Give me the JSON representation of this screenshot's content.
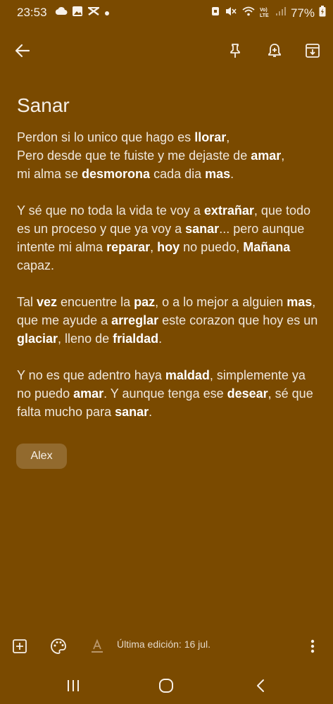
{
  "status_bar": {
    "time": "23:53",
    "battery_percent": "77%",
    "notification_icons": [
      "cloud-icon",
      "gallery-icon",
      "capcut-icon",
      "dot-icon"
    ],
    "system_icons": [
      "alarm-icon",
      "mute-icon",
      "wifi-calling-icon",
      "lte-icon",
      "signal-icon",
      "battery-icon"
    ],
    "network_label": "Vo) LTE"
  },
  "toolbar": {
    "icons": [
      "back-arrow-icon",
      "pin-icon",
      "reminder-icon",
      "archive-icon"
    ]
  },
  "note": {
    "title": "Sanar",
    "paragraphs": [
      [
        {
          "t": "Perdon si lo unico que hago es "
        },
        {
          "t": "llorar",
          "b": true
        },
        {
          "t": ",\nPero desde que te fuiste y me dejaste de "
        },
        {
          "t": "amar",
          "b": true
        },
        {
          "t": ",\nmi alma se "
        },
        {
          "t": "desmorona",
          "b": true
        },
        {
          "t": " cada dia "
        },
        {
          "t": "mas",
          "b": true
        },
        {
          "t": "."
        }
      ],
      [
        {
          "t": "Y sé que no toda la vida te voy a "
        },
        {
          "t": "extrañar",
          "b": true
        },
        {
          "t": ", que todo es un proceso y que ya voy a "
        },
        {
          "t": "sanar",
          "b": true
        },
        {
          "t": "... pero aunque intente mi alma "
        },
        {
          "t": "reparar",
          "b": true
        },
        {
          "t": ", "
        },
        {
          "t": "hoy",
          "b": true
        },
        {
          "t": " no puedo, "
        },
        {
          "t": "Mañana",
          "b": true
        },
        {
          "t": " capaz."
        }
      ],
      [
        {
          "t": "Tal "
        },
        {
          "t": "vez",
          "b": true
        },
        {
          "t": " encuentre la "
        },
        {
          "t": "paz",
          "b": true
        },
        {
          "t": ", o a lo mejor a alguien "
        },
        {
          "t": "mas",
          "b": true
        },
        {
          "t": ", que me ayude a "
        },
        {
          "t": "arreglar",
          "b": true
        },
        {
          "t": " este corazon que hoy es un "
        },
        {
          "t": "glaciar",
          "b": true
        },
        {
          "t": ", lleno de "
        },
        {
          "t": "frialdad",
          "b": true
        },
        {
          "t": "."
        }
      ],
      [
        {
          "t": "Y no es que adentro haya "
        },
        {
          "t": "maldad",
          "b": true
        },
        {
          "t": ", simplemente ya no puedo "
        },
        {
          "t": "amar",
          "b": true
        },
        {
          "t": ". Y aunque tenga ese "
        },
        {
          "t": "desear",
          "b": true
        },
        {
          "t": ", sé que falta mucho para "
        },
        {
          "t": "sanar",
          "b": true
        },
        {
          "t": "."
        }
      ]
    ],
    "label": "Alex",
    "background_color": "#7a4a00"
  },
  "bottom_bar": {
    "icons": [
      "add-box-icon",
      "palette-icon",
      "text-format-icon",
      "more-vert-icon"
    ],
    "edited_text": "Última edición: 16 jul."
  },
  "nav_bar": {
    "icons": [
      "recents-icon",
      "home-icon",
      "back-icon"
    ]
  }
}
